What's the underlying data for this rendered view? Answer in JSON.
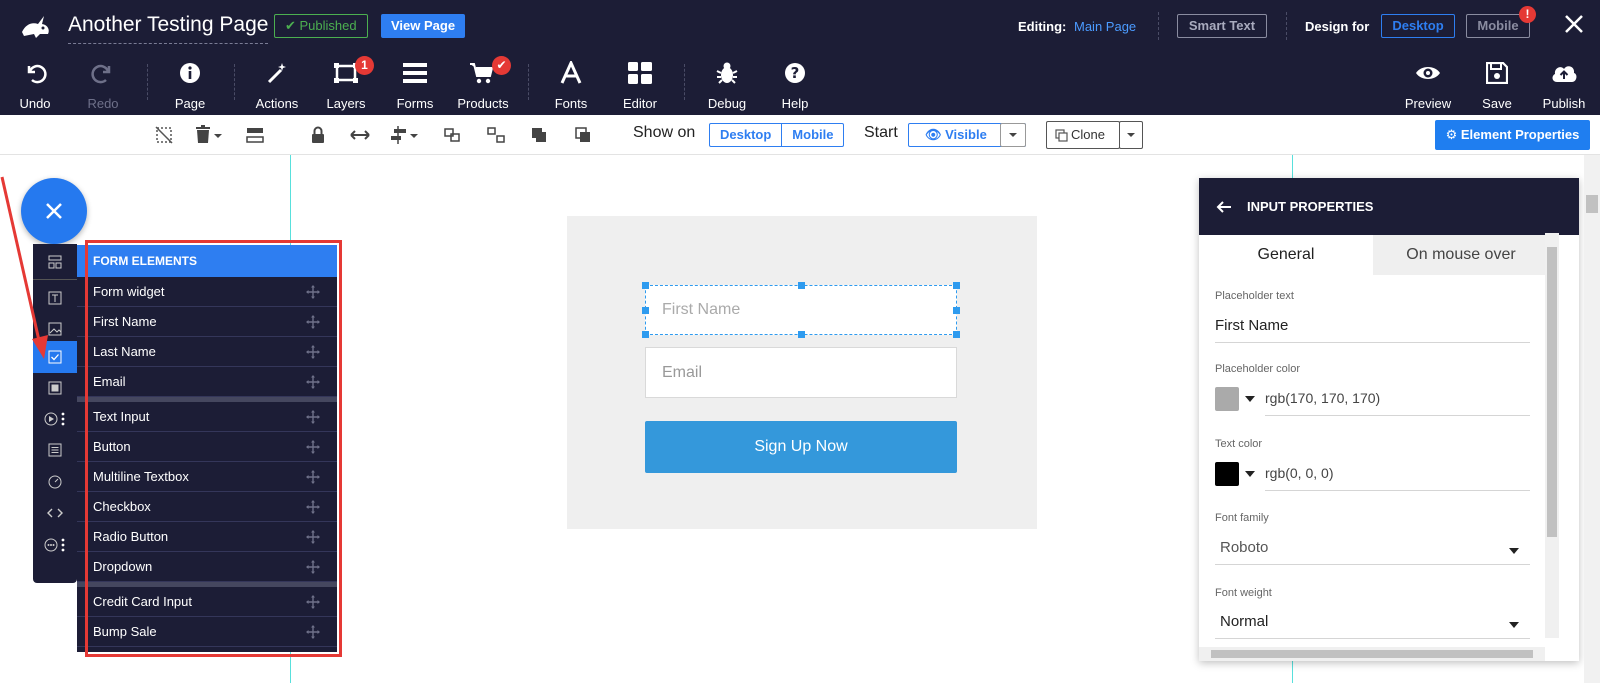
{
  "header": {
    "page_title": "Another Testing Page",
    "published_label": "Published",
    "view_page_label": "View Page",
    "editing_label": "Editing:",
    "editing_value": "Main Page",
    "smart_text_label": "Smart Text",
    "design_for_label": "Design for",
    "desktop_label": "Desktop",
    "mobile_label": "Mobile",
    "mobile_alert": "!"
  },
  "main_toolbar": {
    "undo": "Undo",
    "redo": "Redo",
    "page": "Page",
    "actions": "Actions",
    "layers": "Layers",
    "layers_badge": "1",
    "forms": "Forms",
    "products": "Products",
    "fonts": "Fonts",
    "editor": "Editor",
    "debug": "Debug",
    "help": "Help",
    "preview": "Preview",
    "save": "Save",
    "publish": "Publish"
  },
  "element_toolbar": {
    "show_on_label": "Show on",
    "show_on_options": [
      "Desktop",
      "Mobile"
    ],
    "start_label": "Start",
    "visible_label": "Visible",
    "clone_label": "Clone",
    "element_properties_label": "Element Properties"
  },
  "form_elements": {
    "title": "FORM ELEMENTS",
    "groups": [
      [
        "Form widget",
        "First Name",
        "Last Name",
        "Email"
      ],
      [
        "Text Input",
        "Button",
        "Multiline Textbox",
        "Checkbox",
        "Radio Button",
        "Dropdown"
      ],
      [
        "Credit Card Input",
        "Bump Sale"
      ]
    ]
  },
  "canvas": {
    "first_name_placeholder": "First Name",
    "email_placeholder": "Email",
    "signup_label": "Sign Up Now"
  },
  "input_properties": {
    "title": "INPUT PROPERTIES",
    "tabs": [
      "General",
      "On mouse over"
    ],
    "placeholder_text_label": "Placeholder text",
    "placeholder_text_value": "First Name",
    "placeholder_color_label": "Placeholder color",
    "placeholder_color_value": "rgb(170, 170, 170)",
    "placeholder_color_swatch": "#aaaaaa",
    "text_color_label": "Text color",
    "text_color_value": "rgb(0, 0, 0)",
    "text_color_swatch": "#000000",
    "font_family_label": "Font family",
    "font_family_value": "Roboto",
    "font_weight_label": "Font weight",
    "font_weight_value": "Normal"
  },
  "colors": {
    "topbar": "#1c1d36",
    "accent": "#2e7ef1",
    "published": "#4caf50",
    "alert": "#e53935",
    "signup": "#3498db",
    "guide": "#58e0dc"
  }
}
